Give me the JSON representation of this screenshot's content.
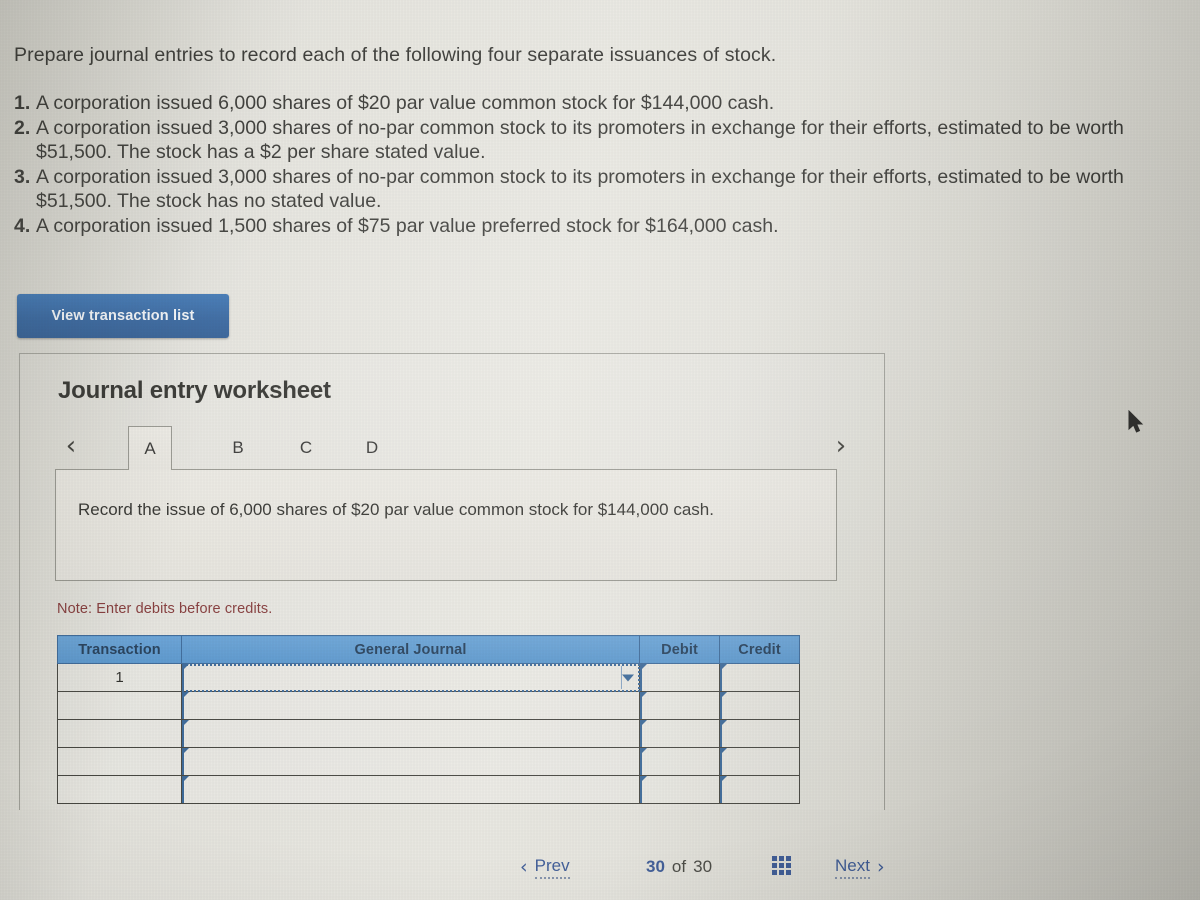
{
  "problem": {
    "prompt": "Prepare journal entries to record each of the following four separate issuances of stock.",
    "items": [
      {
        "num": "1.",
        "text": "A corporation issued 6,000 shares of $20 par value common stock for $144,000 cash."
      },
      {
        "num": "2.",
        "text": "A corporation issued 3,000 shares of no-par common stock to its promoters in exchange for their efforts, estimated to be worth $51,500. The stock has a $2 per share stated value."
      },
      {
        "num": "3.",
        "text": "A corporation issued 3,000 shares of no-par common stock to its promoters in exchange for their efforts, estimated to be worth $51,500. The stock has no stated value."
      },
      {
        "num": "4.",
        "text": "A corporation issued 1,500 shares of $75 par value preferred stock for $164,000 cash."
      }
    ]
  },
  "toolbar": {
    "view_transaction_list_label": "View transaction list"
  },
  "worksheet": {
    "title": "Journal entry worksheet",
    "prev_arrow": "‹",
    "next_arrow": "›",
    "tabs": [
      {
        "label": "A",
        "active": true
      },
      {
        "label": "B",
        "active": false
      },
      {
        "label": "C",
        "active": false
      },
      {
        "label": "D",
        "active": false
      }
    ],
    "instruction": "Record the issue of 6,000 shares of $20 par value common stock for $144,000 cash.",
    "note": "Note: Enter debits before credits."
  },
  "journal_table": {
    "headers": [
      "Transaction",
      "General Journal",
      "Debit",
      "Credit"
    ],
    "rows": [
      {
        "transaction": "1",
        "general_journal": "",
        "debit": "",
        "credit": "",
        "active": true
      },
      {
        "transaction": "",
        "general_journal": "",
        "debit": "",
        "credit": "",
        "active": false
      },
      {
        "transaction": "",
        "general_journal": "",
        "debit": "",
        "credit": "",
        "active": false
      },
      {
        "transaction": "",
        "general_journal": "",
        "debit": "",
        "credit": "",
        "active": false
      },
      {
        "transaction": "",
        "general_journal": "",
        "debit": "",
        "credit": "",
        "active": false
      }
    ]
  },
  "footer": {
    "prev_label": "Prev",
    "prev_chevron": "‹",
    "next_label": "Next",
    "next_chevron": "›",
    "page_current": "30",
    "page_of": "of",
    "page_total": "30",
    "grid_icon": "grid-icon"
  },
  "colors": {
    "button_blue": "#1f5596",
    "header_blue": "#4f90ca",
    "cell_border_blue": "#2f5f92",
    "note_red": "#7c2c2c",
    "link_blue": "#2f4f8f",
    "page_bg": "#e2e1da"
  }
}
